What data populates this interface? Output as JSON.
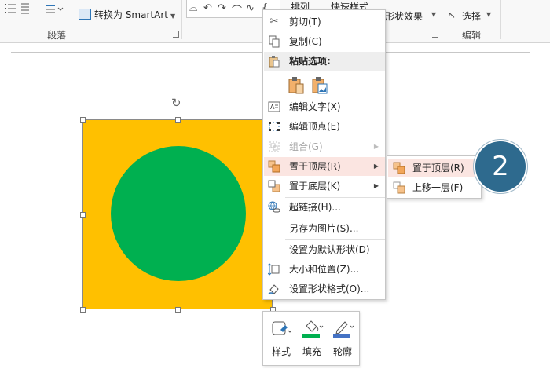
{
  "ribbon": {
    "convert_smartart": "转换为 SmartArt",
    "group_paragraph": "段落",
    "arrange": "排列",
    "quick_styles": "快速样式",
    "shape_effects": "形状效果",
    "select": "选择",
    "group_editing": "编辑"
  },
  "context_menu": {
    "items": [
      {
        "label": "剪切(T)",
        "icon": "scissors-icon"
      },
      {
        "label": "复制(C)",
        "icon": "copy-icon"
      },
      {
        "label": "粘贴选项:",
        "icon": "paste-icon"
      },
      {
        "label": "编辑文字(X)",
        "icon": "edit-text-icon"
      },
      {
        "label": "编辑顶点(E)",
        "icon": "edit-points-icon"
      },
      {
        "label": "组合(G)",
        "icon": "group-icon",
        "disabled": true
      },
      {
        "label": "置于顶层(R)",
        "icon": "bring-to-front-icon",
        "highlighted": true
      },
      {
        "label": "置于底层(K)",
        "icon": "send-to-back-icon"
      },
      {
        "label": "超链接(H)...",
        "icon": "hyperlink-icon"
      },
      {
        "label": "另存为图片(S)...",
        "icon": ""
      },
      {
        "label": "设置为默认形状(D)",
        "icon": ""
      },
      {
        "label": "大小和位置(Z)...",
        "icon": "size-position-icon"
      },
      {
        "label": "设置形状格式(O)...",
        "icon": "format-shape-icon"
      }
    ]
  },
  "submenu": {
    "items": [
      {
        "label": "置于顶层(R)",
        "highlighted": true
      },
      {
        "label": "上移一层(F)"
      }
    ]
  },
  "badge": {
    "number": "2"
  },
  "mini_toolbar": {
    "style": "样式",
    "fill": "填充",
    "outline": "轮廓"
  },
  "colors": {
    "shape_fill": "#ffc000",
    "circle_fill": "#00b050",
    "badge": "#2e6a8e",
    "highlight": "#fbe5e1",
    "fill_bar": "#00b050",
    "outline_bar": "#4472c4"
  }
}
